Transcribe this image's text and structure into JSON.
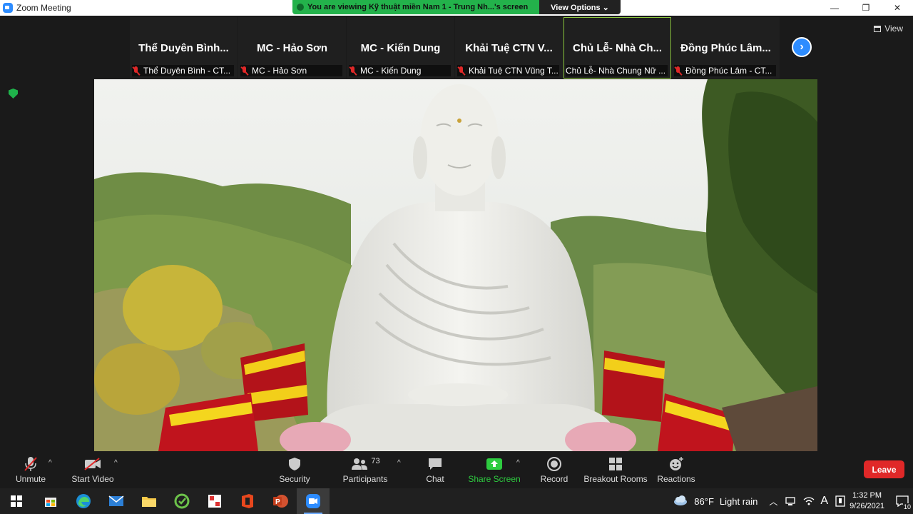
{
  "window": {
    "title": "Zoom Meeting",
    "minimize": "—",
    "restore": "❐",
    "close": "✕"
  },
  "banner": {
    "viewing_text": "You are viewing Kỹ thuật miền Nam 1 - Trung Nh...'s screen",
    "view_options": "View Options ⌄"
  },
  "view_button": "View",
  "participants_strip": [
    {
      "big": "Thể Duyên Bình...",
      "small": "Thể Duyên Bình - CT..."
    },
    {
      "big": "MC - Hảo Sơn",
      "small": "MC - Hảo Sơn"
    },
    {
      "big": "MC - Kiến Dung",
      "small": "MC - Kiến Dung"
    },
    {
      "big": "Khải Tuệ CTN V...",
      "small": "Khải Tuệ CTN Vũng T..."
    },
    {
      "big": "Chủ Lễ- Nhà Ch...",
      "small": "Chủ Lễ- Nhà Chung Nữ ..."
    },
    {
      "big": "Đồng Phúc Lâm...",
      "small": "Đồng Phúc Lâm - CT..."
    }
  ],
  "toolbar": {
    "unmute": "Unmute",
    "start_video": "Start Video",
    "security": "Security",
    "participants": "Participants",
    "participants_count": "73",
    "chat": "Chat",
    "share_screen": "Share Screen",
    "record": "Record",
    "breakout_rooms": "Breakout Rooms",
    "reactions": "Reactions",
    "leave": "Leave"
  },
  "taskbar": {
    "weather_temp": "86°F",
    "weather_desc": "Light rain",
    "time": "1:32 PM",
    "date": "9/26/2021",
    "notifications": "10",
    "lang": "A"
  },
  "colors": {
    "accent_blue": "#2d8cff",
    "banner_green": "#23b24b",
    "leave_red": "#e02828",
    "share_green": "#2ecc40"
  }
}
